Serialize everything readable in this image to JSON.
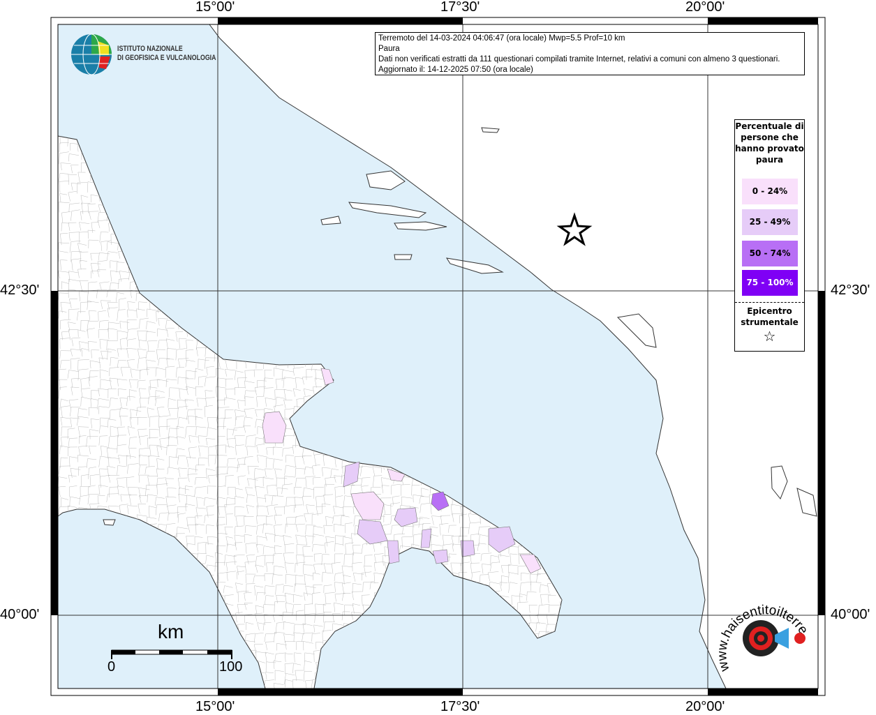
{
  "axes": {
    "lon_labels": [
      "15°00'",
      "17°30'",
      "20°00'"
    ],
    "lat_labels": [
      "42°30'",
      "40°00'"
    ]
  },
  "info": {
    "line1": "Terremoto del 14-03-2024 04:06:47 (ora locale) Mwp=5.5 Prof=10 km",
    "line2": "Paura",
    "line3": "Dati non verificati estratti da 111 questionari compilati tramite Internet, relativi a comuni con almeno 3 questionari.",
    "line4": "Aggiornato il: 14-12-2025 07:50 (ora locale)"
  },
  "legend": {
    "title": "Percentuale di persone che hanno provato paura",
    "classes": [
      {
        "label": "0 - 24%",
        "color": "#f9e0fb"
      },
      {
        "label": "25 - 49%",
        "color": "#e6ccf8"
      },
      {
        "label": "50 - 74%",
        "color": "#b86ff5"
      },
      {
        "label": "75 - 100%",
        "color": "#7f00f5"
      }
    ],
    "epicentre_label": "Epicentro strumentale",
    "epicentre_symbol": "☆"
  },
  "logos": {
    "ingv_line1": "ISTITUTO NAZIONALE",
    "ingv_line2": "DI GEOFISICA E VULCANOLOGIA",
    "hsit": "www.haisentitoilterremoto.it"
  },
  "scale": {
    "unit": "km",
    "min": "0",
    "max": "100"
  },
  "colors": {
    "sea": "#dff0fa",
    "land": "#ffffff"
  }
}
